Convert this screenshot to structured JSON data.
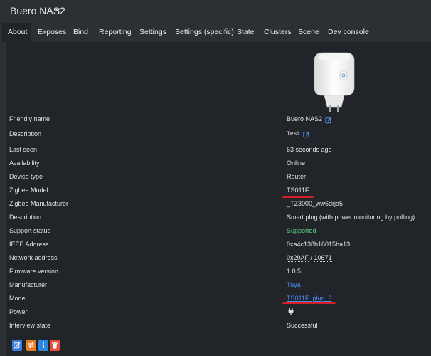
{
  "header": {
    "device_name": "Buero NAS2"
  },
  "tabs": [
    {
      "label": "About"
    },
    {
      "label": "Exposes"
    },
    {
      "label": "Bind"
    },
    {
      "label": "Reporting"
    },
    {
      "label": "Settings"
    },
    {
      "label": "Settings (specific)"
    },
    {
      "label": "State"
    },
    {
      "label": "Clusters"
    },
    {
      "label": "Scene"
    },
    {
      "label": "Dev console"
    }
  ],
  "rows": {
    "friendly_name": {
      "label": "Friendly name",
      "value": "Buero NAS2"
    },
    "description": {
      "label": "Description",
      "value": "Test"
    },
    "last_seen": {
      "label": "Last seen",
      "value": "53 seconds ago"
    },
    "availability": {
      "label": "Availability",
      "value": "Online"
    },
    "device_type": {
      "label": "Device type",
      "value": "Router"
    },
    "zigbee_model": {
      "label": "Zigbee Model",
      "value": "TS011F"
    },
    "zigbee_manufacturer": {
      "label": "Zigbee Manufacturer",
      "value": "_TZ3000_ww6drja5"
    },
    "description2": {
      "label": "Description",
      "value": "Smart plug (with power monitoring by polling)"
    },
    "support_status": {
      "label": "Support status",
      "value": "Supported"
    },
    "ieee_address": {
      "label": "IEEE Address",
      "value": "0xa4c138b16015ba13"
    },
    "network_address": {
      "label": "Network address",
      "hex": "0x29AF",
      "separator": " / ",
      "dec": "10671"
    },
    "firmware_version": {
      "label": "Firmware version",
      "value": "1.0.5"
    },
    "manufacturer": {
      "label": "Manufacturer",
      "value": "Tuya"
    },
    "model": {
      "label": "Model",
      "value": "TS011F_plug_3"
    },
    "power": {
      "label": "Power",
      "icon": "plug-icon"
    },
    "interview_state": {
      "label": "Interview state",
      "value": "Successful"
    }
  },
  "colors": {
    "background": "#2b3035",
    "panel": "#212529",
    "link": "#4d8ff7",
    "supported": "#5fcf80",
    "annotation": "#d81d24",
    "button_primary": "#3b7ddd",
    "button_warning": "#e67e22",
    "button_info": "#2e86de",
    "button_danger": "#e74c3c"
  },
  "actions": [
    "rename-button",
    "reconfigure-button",
    "info-button",
    "delete-button"
  ]
}
